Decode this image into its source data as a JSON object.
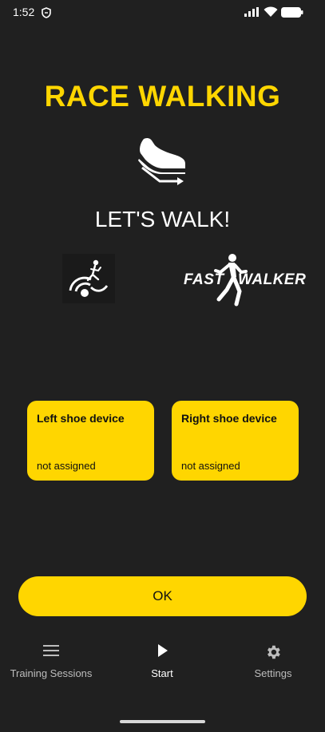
{
  "status_bar": {
    "time": "1:52",
    "icons": [
      "shield-icon",
      "signal-icon",
      "wifi-icon",
      "battery-icon"
    ]
  },
  "header": {
    "title": "RACE WALKING",
    "icon": "shoe-icon",
    "subtitle": "LET'S WALK!"
  },
  "logos": {
    "left": "race-walker-logo",
    "right_part1": "FAST",
    "right_part2": "WALKER"
  },
  "devices": {
    "left": {
      "title": "Left shoe device",
      "status": "not assigned"
    },
    "right": {
      "title": "Right shoe device",
      "status": "not assigned"
    }
  },
  "actions": {
    "ok_label": "OK"
  },
  "bottom_nav": {
    "items": [
      {
        "label": "Training Sessions",
        "icon": "menu-icon",
        "active": false
      },
      {
        "label": "Start",
        "icon": "play-icon",
        "active": true
      },
      {
        "label": "Settings",
        "icon": "gear-icon",
        "active": false
      }
    ]
  },
  "colors": {
    "accent": "#FFD600",
    "background": "#202020",
    "text": "#FFFFFF",
    "nav_inactive": "#BDBDBD"
  }
}
